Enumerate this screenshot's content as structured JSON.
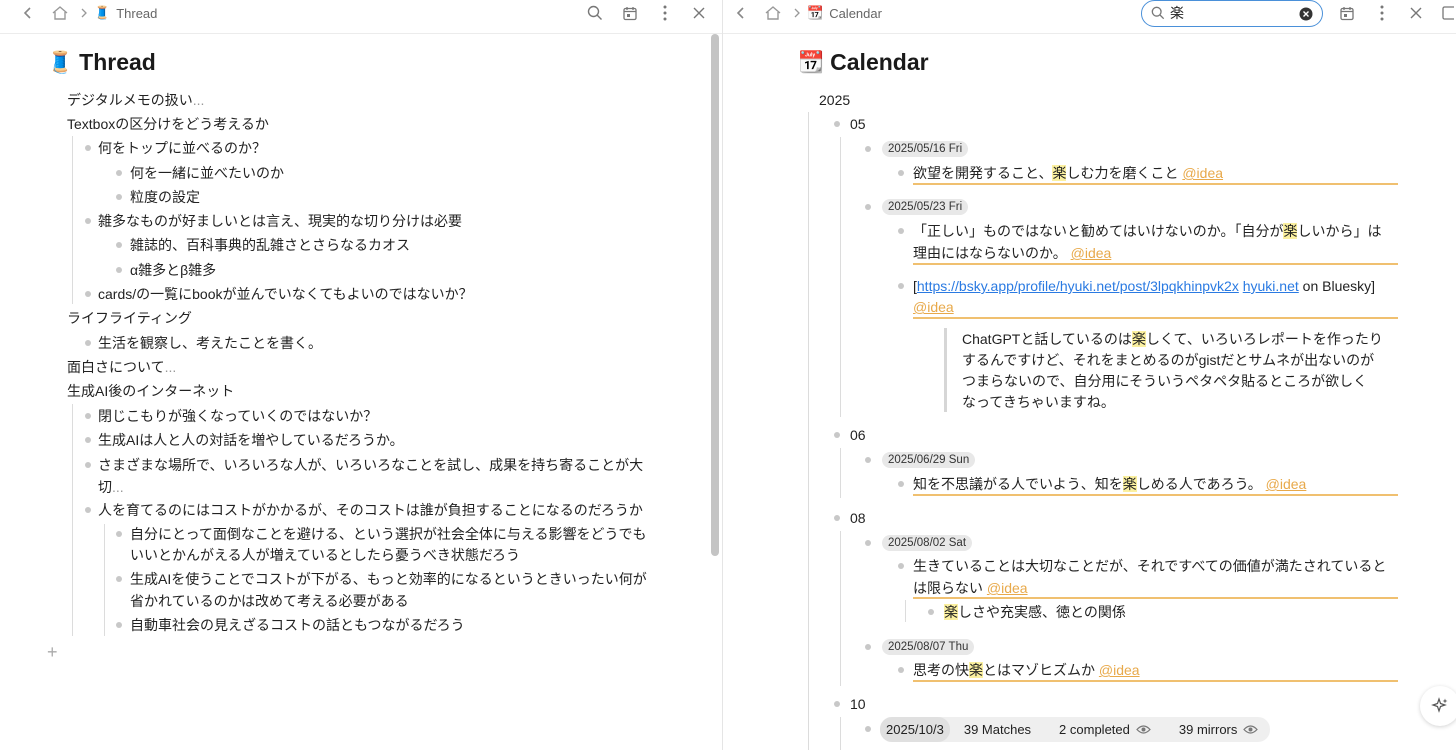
{
  "left": {
    "tab_title": "Thread",
    "page_title": "Thread",
    "items": {
      "i0": "デジタルメモの扱い",
      "i1": "Textboxの区分けをどう考えるか",
      "i2": "何をトップに並べるのか？",
      "i3": "何を一緒に並べたいのか",
      "i4": "粒度の設定",
      "i5": "雑多なものが好ましいとは言え、現実的な切り分けは必要",
      "i6": "雑誌的、百科事典的乱雑さとさらなるカオス",
      "i7": "α雑多とβ雑多",
      "i8": "cards/の一覧にbookが並んでいなくてもよいのではないか？",
      "i9": "ライフライティング",
      "i10": "生活を観察し、考えたことを書く。",
      "i11": "面白さについて",
      "i12": "生成AI後のインターネット",
      "i13": "閉じこもりが強くなっていくのではないか？",
      "i14": "生成AIは人と人の対話を増やしているだろうか。",
      "i15a": "さまざまな場所で、いろいろな人が、いろいろなことを試し、成果を持ち寄ることが大",
      "i15b": "切",
      "i16": "人を育てるのにはコストがかかるが、そのコストは誰が負担することになるのだろうか",
      "i17a": "自分にとって面倒なことを避ける、という選択が社会全体に与える影響をどうでも",
      "i17b": "いいとかんがえる人が増えているとしたら憂うべき状態だろう",
      "i18a": "生成AIを使うことでコストが下がる、もっと効率的になるというときいったい何が",
      "i18b": "省かれているのかは改めて考える必要がある",
      "i19": "自動車社会の見えざるコストの話ともつながるだろう"
    },
    "ellipsis": "..."
  },
  "right": {
    "tab_title": "Calendar",
    "page_title": "Calendar",
    "search_value": "楽",
    "year": "2025",
    "months": {
      "m05": "05",
      "m06": "06",
      "m08": "08",
      "m10": "10"
    },
    "dates": {
      "d1": "2025/05/16 Fri",
      "d2": "2025/05/23 Fri",
      "d3": "2025/06/29 Sun",
      "d4": "2025/08/02 Sat",
      "d5": "2025/08/07 Thu",
      "d6": "2025/10/3"
    },
    "entries": {
      "e1_pre": "欲望を開発すること、",
      "e1_hl": "楽",
      "e1_post": "しむ力を磨くこと",
      "e2_l1_pre": "「正しい」ものではないと勧めてはいけないのか。「自分が",
      "e2_l1_hl": "楽",
      "e2_l1_post": "しいから」は",
      "e2_l2": "理由にはならないのか。",
      "e3_bracket_open": "[",
      "e3_link1": "https://bsky.app/profile/hyuki.net/post/3lpqkhinpvk2x",
      "e3_link2": "hyuki.net",
      "e3_tail": "on Bluesky]",
      "q_l1_pre": "ChatGPTと話しているのは",
      "q_l1_hl": "楽",
      "q_l1_post": "しくて、いろいろレポートを作ったり",
      "q_l2": "するんですけど、それをまとめるのがgistだとサムネが出ないのが",
      "q_l3": "つまらないので、自分用にそういうペタペタ貼るところが欲しく",
      "q_l4": "なってきちゃいますね。",
      "e4_pre": "知を不思議がる人でいよう、知を",
      "e4_hl": "楽",
      "e4_post": "しめる人であろう。",
      "e5_l1": "生きていることは大切なことだが、それですべての価値が満たされていると",
      "e5_l2": "は限らない",
      "e6_hl": "楽",
      "e6_post": "しさや充実感、徳との関係",
      "e7_pre": "思考の快",
      "e7_hl": "楽",
      "e7_post": "とはマゾヒズムか"
    },
    "tag": "@idea",
    "status": {
      "matches": "39 Matches",
      "completed": "2 completed",
      "mirrors": "39 mirrors"
    }
  },
  "colors": {
    "highlight": "#fbf0a0",
    "tag": "#e8a94a",
    "link": "#2a7ae2",
    "search_border": "#4a90d9",
    "underline": "#f0c070"
  },
  "icons": [
    "back-icon",
    "home-icon",
    "chevron-right-icon",
    "spool-icon",
    "search-icon",
    "calendar-icon",
    "more-icon",
    "close-icon",
    "clear-icon",
    "eye-icon",
    "sparkle-icon",
    "plus-icon"
  ]
}
